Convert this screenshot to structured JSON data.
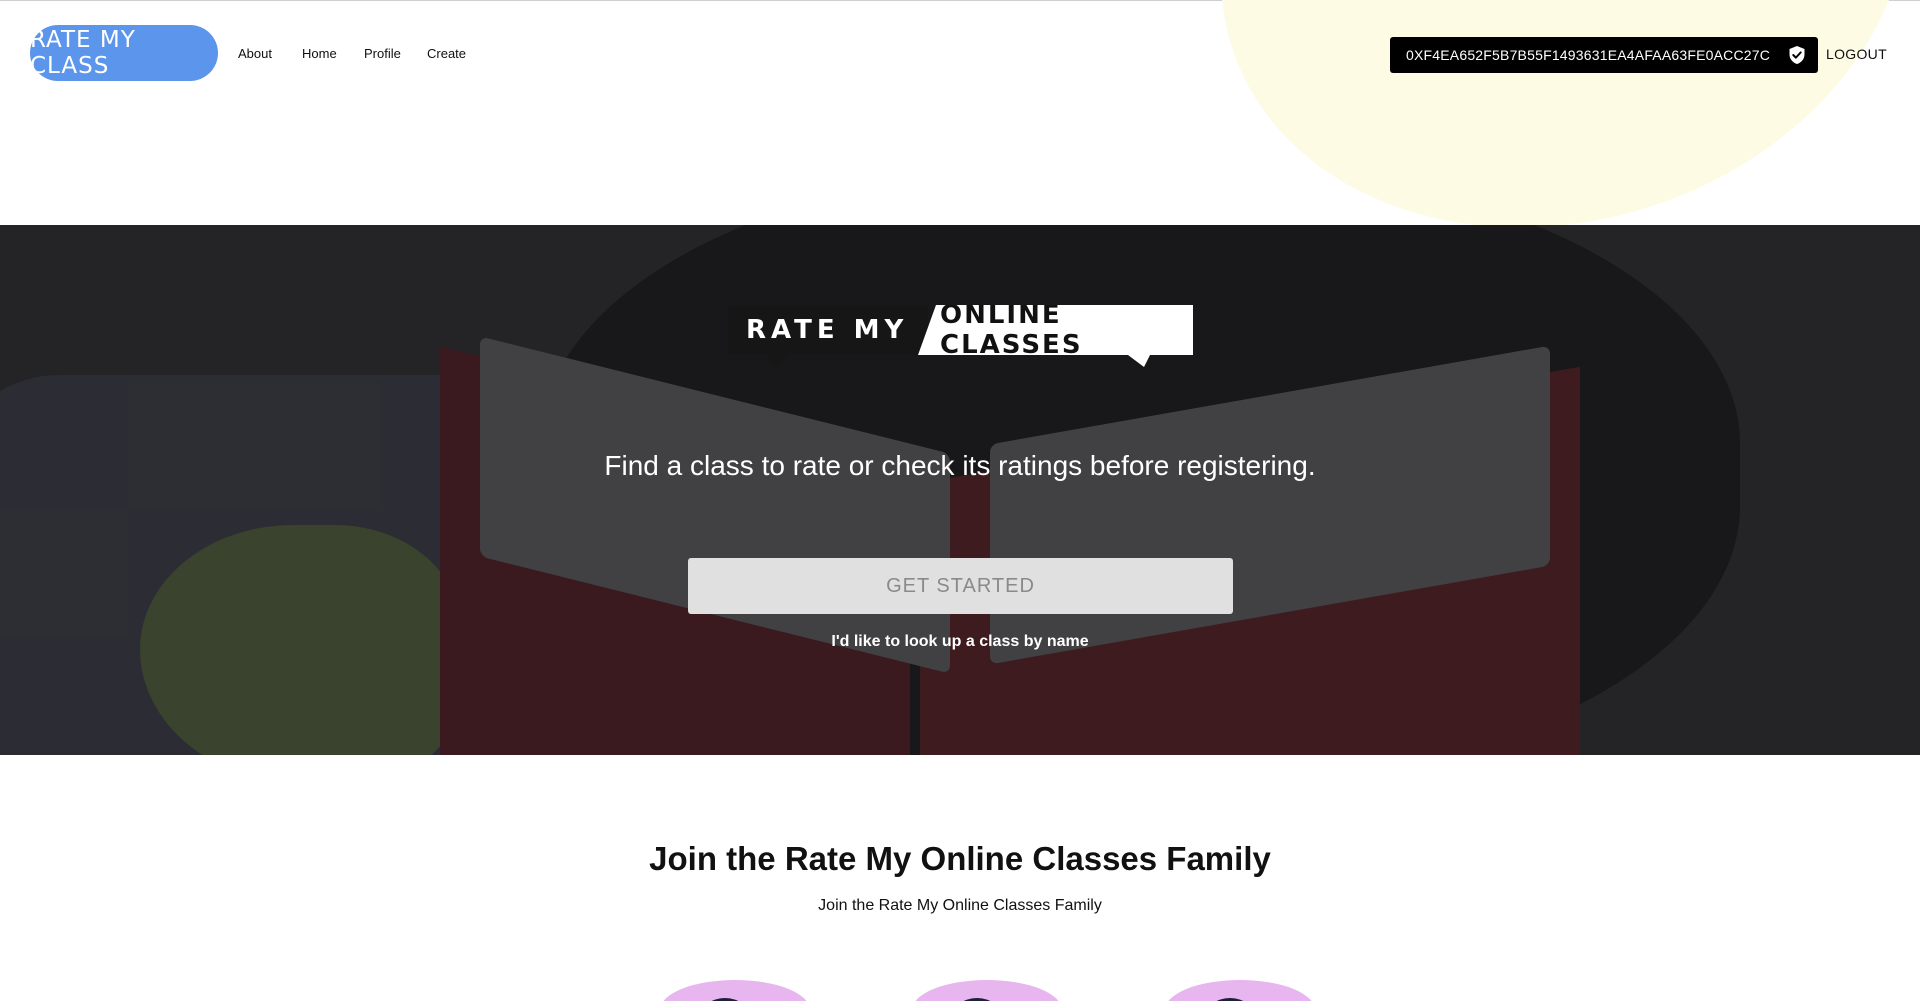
{
  "header": {
    "logo_text": "RATE MY CLASS",
    "nav": [
      "About",
      "Home",
      "Profile",
      "Create"
    ],
    "wallet_address": "0XF4EA652F5B7B55F1493631EA4AFAA63FE0ACC27C",
    "logout_label": "LOGOUT"
  },
  "hero": {
    "brand_left": "RATE MY",
    "brand_right": "ONLINE CLASSES",
    "tagline": "Find a class to rate or check its ratings before registering.",
    "cta_label": "GET STARTED",
    "lookup_link": "I'd like to look up a class by name"
  },
  "join": {
    "title": "Join the Rate My Online Classes Family",
    "subtitle": "Join the Rate My Online Classes Family"
  },
  "colors": {
    "logo_bg": "#5c95ec",
    "wallet_bg": "#000000",
    "cta_bg": "#e0e0e0",
    "accent_blob": "#fdfbe3",
    "avatar_blob": "#e7b6ef"
  },
  "icons": {
    "wallet_verified": "shield-check-icon"
  }
}
